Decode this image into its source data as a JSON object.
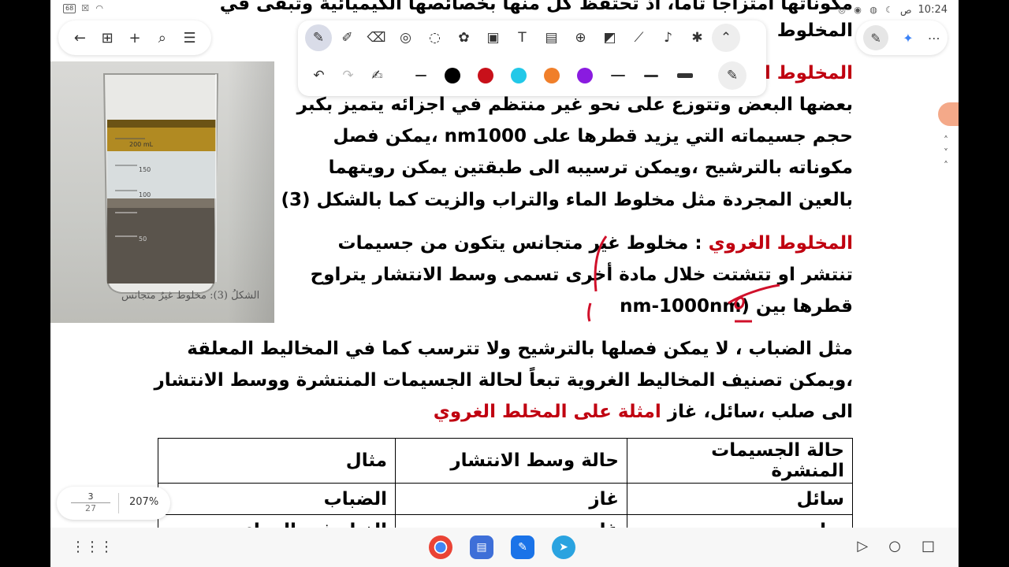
{
  "status": {
    "time": "10:24",
    "am_pm": "ص",
    "battery": "68"
  },
  "document": {
    "lines": [
      {
        "id": "l0",
        "text": "مكوناتها امتزاجا تاما، اذ تحتفظ كل منها بخصائصها الكيميائية وتبقى في"
      },
      {
        "id": "l1",
        "text": "المخلوط"
      },
      {
        "id": "l2a",
        "text": "المخلوط ا"
      },
      {
        "id": "l3",
        "text": "بعضها البعض وتتوزع على نحو غير منتظم في أجزائه يتميز بكبر"
      },
      {
        "id": "l4",
        "text": "حجم جسيماته التي يزيد قطرها على nm1000 ،يمكن فصل"
      },
      {
        "id": "l5",
        "text": "مكوناته بالترشيح ،ويمكن ترسيبه  الى طبقتين يمكن رويتهما"
      },
      {
        "id": "l6",
        "text": "بالعين المجردة مثل مخلوط الماء والتراب والزيت كما بالشكل (3)"
      },
      {
        "id": "l7_red",
        "text": "المخلوط الغروي"
      },
      {
        "id": "l7",
        "text": " : مخلوط غير متجانس يتكون من جسيمات"
      },
      {
        "id": "l8",
        "text": "تنتشر او تتشتت خلال مادة أخرى تسمى وسط الانتشار يتراوح"
      },
      {
        "id": "l9",
        "text": "قطرها بين (nm-1000nm"
      },
      {
        "id": "l10",
        "text": "مثل الضباب ، لا يمكن فصلها بالترشيح ولا تترسب كما في المخاليط المعلقة"
      },
      {
        "id": "l11",
        "text": "،ويمكن تصنيف المخاليط الغروية تبعاً لحالة الجسيمات المنتشرة  ووسط الانتشار"
      },
      {
        "id": "l12",
        "text": "الى صلب ،سائل، غاز "
      },
      {
        "id": "l12_red",
        "text": "امثلة على المخلط الغروي"
      }
    ],
    "figure_caption": "الشكلُ (3): مخلوط غيرُ متجانس",
    "beaker_marks": [
      "200 mL",
      "150",
      "100",
      "50"
    ],
    "table": {
      "headers": [
        "حالة الجسيمات المنشرة",
        "حالة وسط الانتشار",
        "مثال"
      ],
      "rows": [
        [
          "سائل",
          "غاز",
          "الضباب"
        ],
        [
          "صلب",
          "غاز",
          "الغبار فى الهواء"
        ]
      ]
    }
  },
  "toolbar": {
    "tools": [
      "pen-icon",
      "highlighter-icon",
      "eraser-icon",
      "lasso-icon",
      "shape-icon",
      "sticker-icon",
      "image-icon",
      "text-icon",
      "table-icon",
      "zoom-icon",
      "chart-icon",
      "ruler-icon",
      "mic-icon",
      "laser-icon",
      "collapse-icon"
    ],
    "colors": [
      "#000000",
      "#c8101a",
      "#22c8e8",
      "#f07f2a",
      "#8a1be0"
    ],
    "accent": "#3b5bdb"
  },
  "page_indicator": {
    "current": "3",
    "total": "27",
    "zoom": "207%"
  }
}
